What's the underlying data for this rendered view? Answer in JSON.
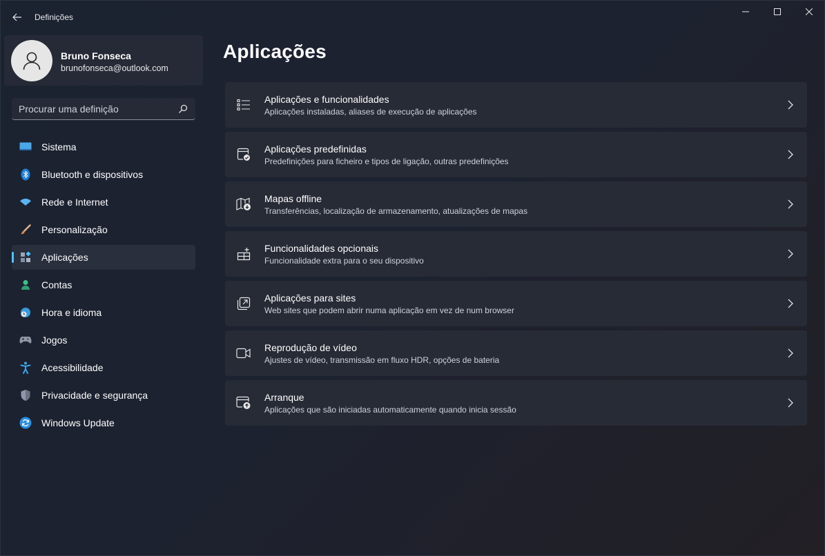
{
  "window": {
    "title": "Definições"
  },
  "colors": {
    "accent": "#4cc2ff",
    "card_bg": "#262b36",
    "sidebar_active": "#2a2f3d"
  },
  "profile": {
    "name": "Bruno Fonseca",
    "email": "brunofonseca@outlook.com",
    "avatar_icon": "person-icon"
  },
  "search": {
    "placeholder": "Procurar uma definição",
    "icon": "search-icon"
  },
  "nav": {
    "items": [
      {
        "label": "Sistema",
        "icon": "monitor-icon",
        "active": false
      },
      {
        "label": "Bluetooth e dispositivos",
        "icon": "bluetooth-icon",
        "active": false
      },
      {
        "label": "Rede e Internet",
        "icon": "wifi-icon",
        "active": false
      },
      {
        "label": "Personalização",
        "icon": "brush-icon",
        "active": false
      },
      {
        "label": "Aplicações",
        "icon": "apps-icon",
        "active": true
      },
      {
        "label": "Contas",
        "icon": "account-icon",
        "active": false
      },
      {
        "label": "Hora e idioma",
        "icon": "clock-globe-icon",
        "active": false
      },
      {
        "label": "Jogos",
        "icon": "gamepad-icon",
        "active": false
      },
      {
        "label": "Acessibilidade",
        "icon": "accessibility-icon",
        "active": false
      },
      {
        "label": "Privacidade e segurança",
        "icon": "shield-icon",
        "active": false
      },
      {
        "label": "Windows Update",
        "icon": "update-icon",
        "active": false
      }
    ]
  },
  "main": {
    "title": "Aplicações",
    "cards": [
      {
        "title": "Aplicações e funcionalidades",
        "desc": "Aplicações instaladas, aliases de execução de aplicações",
        "icon": "list-icon"
      },
      {
        "title": "Aplicações predefinidas",
        "desc": "Predefinições para ficheiro e tipos de ligação, outras predefinições",
        "icon": "default-apps-icon"
      },
      {
        "title": "Mapas offline",
        "desc": "Transferências, localização de armazenamento, atualizações de mapas",
        "icon": "map-download-icon"
      },
      {
        "title": "Funcionalidades opcionais",
        "desc": "Funcionalidade extra para o seu dispositivo",
        "icon": "add-apps-icon"
      },
      {
        "title": "Aplicações para sites",
        "desc": "Web sites que podem abrir numa aplicação em vez de num browser",
        "icon": "open-external-icon"
      },
      {
        "title": "Reprodução de vídeo",
        "desc": "Ajustes de vídeo, transmissão em fluxo HDR, opções de bateria",
        "icon": "video-icon"
      },
      {
        "title": "Arranque",
        "desc": "Aplicações que são iniciadas automaticamente quando inicia sessão",
        "icon": "startup-icon"
      }
    ]
  }
}
